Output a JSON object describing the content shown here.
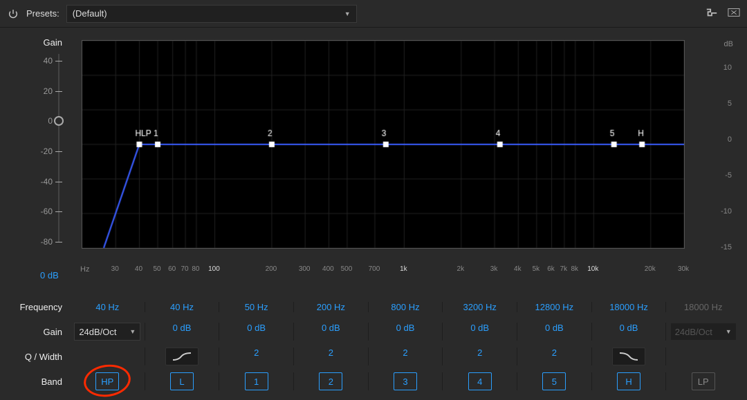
{
  "topbar": {
    "presets_label": "Presets:",
    "preset_value": "(Default)"
  },
  "gain_axis": {
    "label": "Gain",
    "ticks": [
      "40",
      "20",
      "0",
      "-20",
      "-40",
      "-60",
      "-80"
    ],
    "value": "0 dB"
  },
  "right_axis": {
    "unit": "dB",
    "ticks": [
      "10",
      "5",
      "0",
      "-5",
      "-10",
      "-15"
    ]
  },
  "x_axis": {
    "unit": "Hz",
    "ticks": [
      "30",
      "40",
      "50",
      "60",
      "70",
      "80",
      "100",
      "200",
      "300",
      "400",
      "500",
      "700",
      "1k",
      "2k",
      "3k",
      "4k",
      "5k",
      "6k",
      "7k",
      "8k",
      "10k",
      "20k",
      "30k"
    ]
  },
  "rows": {
    "frequency_label": "Frequency",
    "gain_label": "Gain",
    "q_label": "Q / Width",
    "band_label": "Band"
  },
  "bands": [
    {
      "name": "HP",
      "freq": "40 Hz",
      "gain": "24dB/Oct",
      "q": "",
      "btn": "HP",
      "selected": true
    },
    {
      "name": "L",
      "freq": "40 Hz",
      "gain": "0 dB",
      "q": "shape",
      "btn": "L"
    },
    {
      "name": "1",
      "freq": "50 Hz",
      "gain": "0 dB",
      "q": "2",
      "btn": "1"
    },
    {
      "name": "2",
      "freq": "200 Hz",
      "gain": "0 dB",
      "q": "2",
      "btn": "2"
    },
    {
      "name": "3",
      "freq": "800 Hz",
      "gain": "0 dB",
      "q": "2",
      "btn": "3"
    },
    {
      "name": "4",
      "freq": "3200 Hz",
      "gain": "0 dB",
      "q": "2",
      "btn": "4"
    },
    {
      "name": "5",
      "freq": "12800 Hz",
      "gain": "0 dB",
      "q": "2",
      "btn": "5"
    },
    {
      "name": "H",
      "freq": "18000 Hz",
      "gain": "0 dB",
      "q": "shape2",
      "btn": "H"
    },
    {
      "name": "LP",
      "freq": "18000 Hz",
      "gain": "24dB/Oct",
      "q": "",
      "btn": "LP",
      "disabled": true
    }
  ],
  "chart_data": {
    "type": "line",
    "xlabel": "Hz",
    "ylabel": "dB",
    "x_scale": "log",
    "x_range": [
      20,
      30000
    ],
    "y_range": [
      -15,
      15
    ],
    "hp_cutoff_hz": 40,
    "hp_slope_db_oct": 24,
    "markers": [
      {
        "label": "HLP",
        "hz": 40,
        "db": 0
      },
      {
        "label": "1",
        "hz": 50,
        "db": 0
      },
      {
        "label": "2",
        "hz": 200,
        "db": 0
      },
      {
        "label": "3",
        "hz": 800,
        "db": 0
      },
      {
        "label": "4",
        "hz": 3200,
        "db": 0
      },
      {
        "label": "5",
        "hz": 12800,
        "db": 0
      },
      {
        "label": "H",
        "hz": 18000,
        "db": 0
      }
    ],
    "gridlines_x": [
      30,
      40,
      50,
      60,
      70,
      80,
      100,
      200,
      300,
      400,
      500,
      700,
      1000,
      2000,
      3000,
      4000,
      5000,
      6000,
      7000,
      8000,
      10000,
      20000,
      30000
    ],
    "gridlines_y": [
      -15,
      -10,
      -5,
      0,
      5,
      10,
      15
    ]
  },
  "annotation": {
    "circled_band": "HP"
  }
}
